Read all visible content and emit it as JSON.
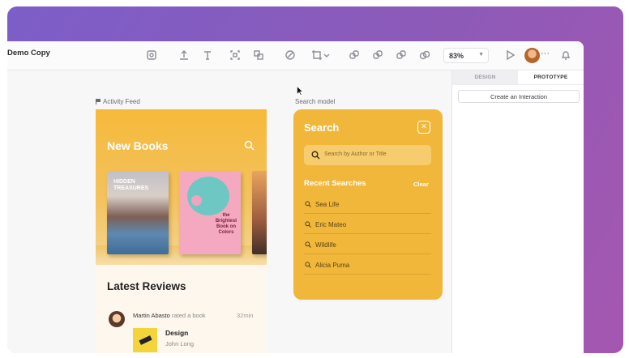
{
  "window": {
    "doc_title": "Demo Copy",
    "zoom": "83%",
    "toolbar_icons": [
      "frame-icon",
      "upload-icon",
      "text-tool-icon",
      "select-frame-icon",
      "group-icon",
      "pen-icon",
      "crop-icon",
      "component-icon",
      "union-icon",
      "intersect-icon",
      "mask-icon",
      "play-icon",
      "bell-icon"
    ]
  },
  "inspector": {
    "tabs": [
      {
        "label": "DESIGN"
      },
      {
        "label": "PROTOTYPE"
      }
    ],
    "active_tab": "PROTOTYPE",
    "create_interaction": "Create an Interaction"
  },
  "canvas": {
    "frames": [
      {
        "label": "Activity Feed"
      },
      {
        "label": "Search model"
      }
    ]
  },
  "activity_feed": {
    "hero_title": "New Books",
    "books": [
      {
        "title": "HIDDEN TREASURES"
      },
      {
        "title": "the Brightest Book on Colors"
      }
    ],
    "reviews_title": "Latest Reviews",
    "review": {
      "user": "Martin Abasto",
      "action": "rated a book",
      "time": "32min",
      "book_title": "Design",
      "author": "John Long"
    }
  },
  "search_modal": {
    "title": "Search",
    "placeholder": "Search by Author or Title",
    "recent_label": "Recent Searches",
    "clear_label": "Clear",
    "recent": [
      "Sea Life",
      "Eric Mateo",
      "Wildlife",
      "Alicia Puma"
    ]
  }
}
